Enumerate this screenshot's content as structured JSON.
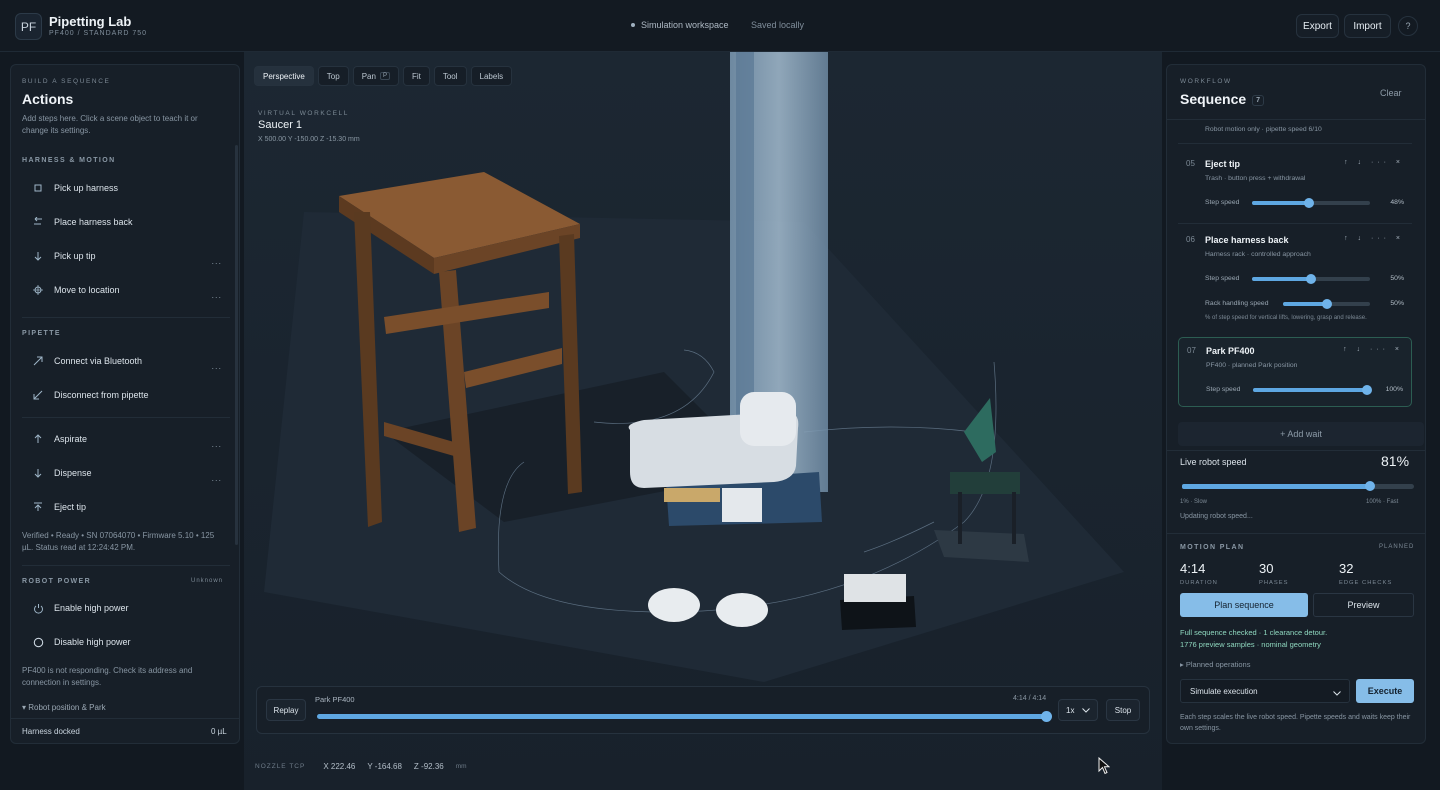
{
  "app": {
    "logo": "PF",
    "title": "Pipetting Lab",
    "subtitle": "PF400 / STANDARD 750",
    "workspace": "Simulation workspace",
    "saved": "Saved locally",
    "export_label": "Export",
    "import_label": "Import",
    "help_label": "?"
  },
  "actions": {
    "kicker": "BUILD A SEQUENCE",
    "title": "Actions",
    "description": "Add steps here. Click a scene object to teach it or change its settings.",
    "harness_section": "HARNESS & MOTION",
    "harness_items": [
      {
        "label": "Pick up harness",
        "icon": "harness-icon",
        "more": ""
      },
      {
        "label": "Place harness back",
        "icon": "return-arrow-icon",
        "more": ""
      },
      {
        "label": "Pick up tip",
        "icon": "arrow-down-icon",
        "more": "..."
      },
      {
        "label": "Move to location",
        "icon": "crosshair-icon",
        "more": "..."
      }
    ],
    "pipette_section": "PIPETTE",
    "pipette_items": [
      {
        "label": "Connect via Bluetooth",
        "icon": "arrow-up-right-icon",
        "more": "..."
      },
      {
        "label": "Disconnect from pipette",
        "icon": "arrow-down-left-icon",
        "more": ""
      },
      {
        "label": "Aspirate",
        "icon": "arrow-up-icon",
        "more": "..."
      },
      {
        "label": "Dispense",
        "icon": "arrow-down-icon",
        "more": "..."
      },
      {
        "label": "Eject tip",
        "icon": "eject-icon",
        "more": ""
      }
    ],
    "pipette_status": "Verified • Ready • SN 07064070 • Firmware 5.10 • 125 µL. Status read at 12:24:42 PM.",
    "power_section": "ROBOT POWER",
    "power_state": "Unknown",
    "power_items": [
      {
        "label": "Enable high power",
        "icon": "power-icon"
      },
      {
        "label": "Disable high power",
        "icon": "circle-icon"
      }
    ],
    "power_note": "PF400 is not responding. Check its address and connection in settings.",
    "position_toggle": "▾ Robot position & Park",
    "harness_status": "Harness docked",
    "harness_volume": "0 µL"
  },
  "viewport": {
    "tabs": [
      "Perspective",
      "Top",
      "Pan",
      "Fit",
      "Tool",
      "Labels"
    ],
    "pan_key": "P",
    "active_tab": "Perspective",
    "workcell_kicker": "VIRTUAL WORKCELL",
    "workcell_title": "Saucer 1",
    "workcell_coords": "X 500.00 Y -150.00 Z -15.30 mm"
  },
  "player": {
    "replay_label": "Replay",
    "title": "Park PF400",
    "time": "4:14 / 4:14",
    "progress": 1.0,
    "speed": "1x",
    "stop_label": "Stop"
  },
  "nozzle": {
    "label": "NOZZLE TCP",
    "x": "X 222.46",
    "y": "Y -164.68",
    "z": "Z -92.36",
    "unit": "mm"
  },
  "sequence": {
    "kicker": "WORKFLOW",
    "title": "Sequence",
    "count": "7",
    "clear_label": "Clear",
    "prev_step_sub": "Robot motion only · pipette speed 6/10",
    "steps": [
      {
        "num": "05",
        "title": "Eject tip",
        "sub": "Trash · button press + withdrawal",
        "step_speed_label": "Step speed",
        "step_speed_value": "48%",
        "step_speed": 0.48
      },
      {
        "num": "06",
        "title": "Place harness back",
        "sub": "Harness rack · controlled approach",
        "step_speed_label": "Step speed",
        "step_speed_value": "50%",
        "step_speed": 0.5,
        "rack_label": "Rack handling speed",
        "rack_value": "50%",
        "rack_speed": 0.5,
        "rack_note": "% of step speed for vertical lifts, lowering, grasp and release."
      },
      {
        "num": "07",
        "title": "Park PF400",
        "sub": "PF400 · planned Park position",
        "step_speed_label": "Step speed",
        "step_speed_value": "100%",
        "step_speed": 1.0
      }
    ],
    "step_controls": "↑ ↓ ··· ×",
    "add_wait": "+ Add wait",
    "live_label": "Live robot speed",
    "live_value": "81%",
    "live_speed": 0.81,
    "live_min": "1% · Slow",
    "live_max": "100% · Fast",
    "live_status": "Updating robot speed...",
    "plan_label": "MOTION PLAN",
    "plan_state": "PLANNED",
    "stats": [
      {
        "value": "4:14",
        "caption": "DURATION"
      },
      {
        "value": "30",
        "caption": "PHASES"
      },
      {
        "value": "32",
        "caption": "EDGE CHECKS"
      }
    ],
    "plan_button": "Plan sequence",
    "preview_button": "Preview",
    "check_line1": "Full sequence checked · 1 clearance detour.",
    "check_line2": "1776 preview samples · nominal geometry",
    "planned_ops": "▸ Planned operations",
    "mode": "Simulate execution",
    "execute_label": "Execute",
    "footer": "Each step scales the live robot speed. Pipette speeds and waits keep their own settings."
  },
  "colors": {
    "accent": "#5ea7e2",
    "primary_button": "#86bde8",
    "check_text": "#8fd8bf",
    "background": "#121921"
  }
}
